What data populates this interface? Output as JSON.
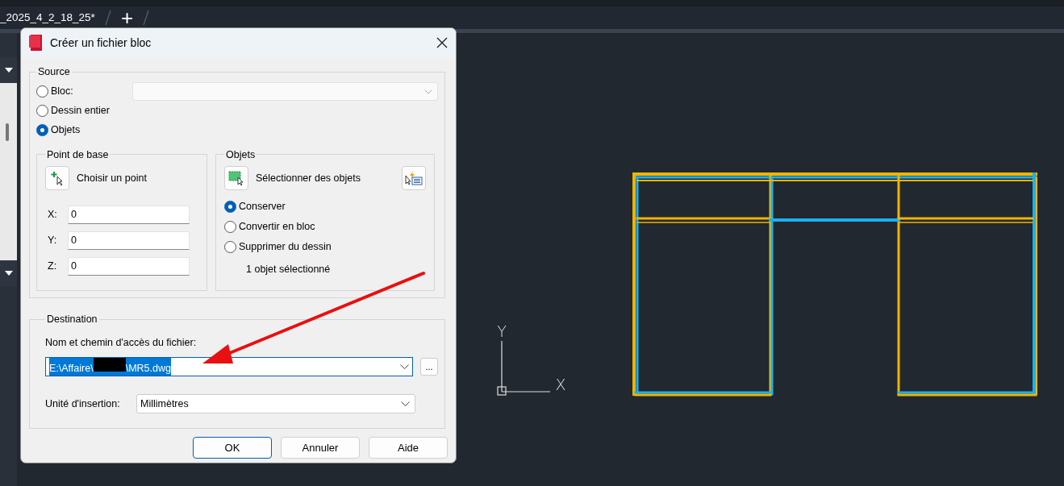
{
  "app": {
    "tabs": [
      {
        "label": "_2025_4_2_18_25*",
        "selected": true
      }
    ],
    "new_tab": "+"
  },
  "dialog": {
    "title": "Créer un fichier bloc",
    "source": {
      "legend": "Source",
      "options": [
        {
          "label": "Bloc:",
          "selected": false
        },
        {
          "label": "Dessin entier",
          "selected": false
        },
        {
          "label": "Objets",
          "selected": true
        }
      ],
      "block_dropdown": {
        "disabled": true
      }
    },
    "base_point": {
      "legend": "Point de base",
      "pick_label": "Choisir un point",
      "coords": [
        {
          "label": "X:",
          "value": "0"
        },
        {
          "label": "Y:",
          "value": "0"
        },
        {
          "label": "Z:",
          "value": "0"
        }
      ]
    },
    "objects": {
      "legend": "Objets",
      "select_label": "Sélectionner des objets",
      "options": [
        {
          "label": "Conserver",
          "selected": true
        },
        {
          "label": "Convertir en bloc",
          "selected": false
        },
        {
          "label": "Supprimer du dessin",
          "selected": false
        }
      ],
      "status": "1 objet sélectionné"
    },
    "destination": {
      "legend": "Destination",
      "path_label": "Nom et chemin d'accès du fichier:",
      "path_value_start": "E:\\Affaire\\",
      "path_value_end": "\\MR5.dwg",
      "browse": "...",
      "unit_label": "Unité d'insertion:",
      "unit_value": "Millimètres"
    },
    "buttons": [
      {
        "label": "OK",
        "default": true
      },
      {
        "label": "Annuler",
        "default": false
      },
      {
        "label": "Aide",
        "default": false
      }
    ]
  },
  "canvas": {
    "axis_y": "Y",
    "axis_x": "X"
  }
}
